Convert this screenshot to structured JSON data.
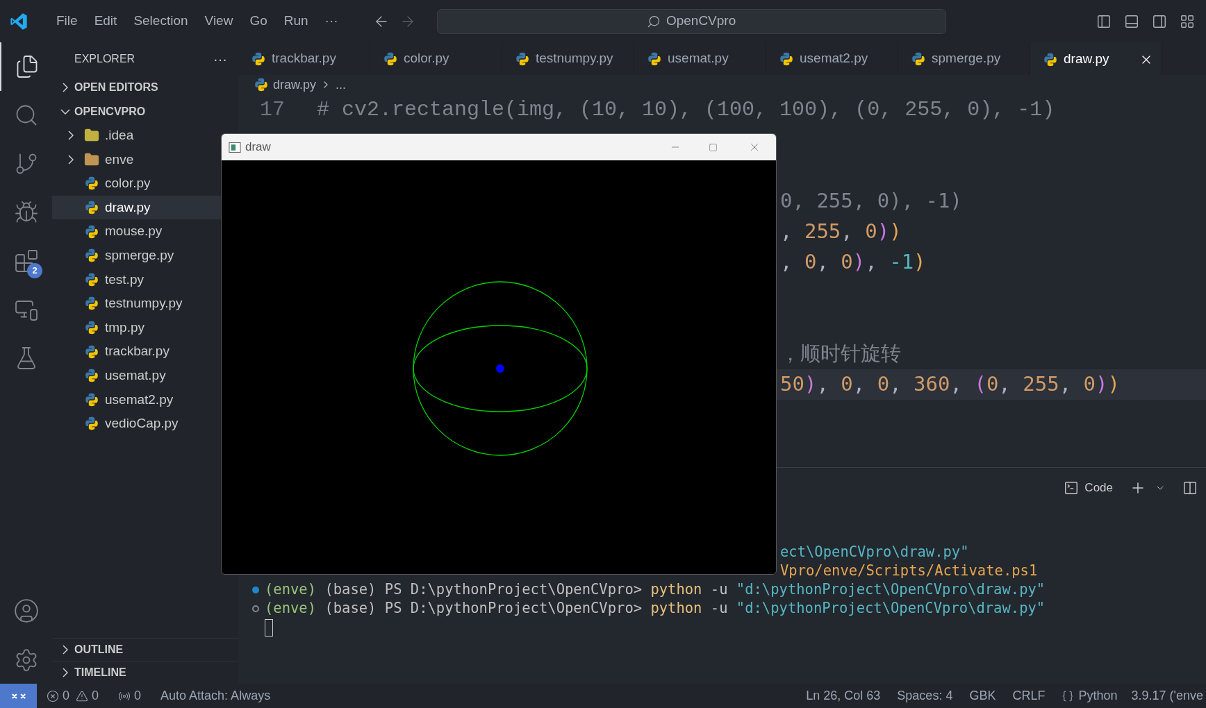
{
  "menu": [
    "File",
    "Edit",
    "Selection",
    "View",
    "Go",
    "Run",
    "···"
  ],
  "search": {
    "value": "OpenCVpro"
  },
  "activity": [
    {
      "selected": true
    },
    {
      "selected": false
    },
    {
      "selected": false
    },
    {
      "selected": false
    },
    {
      "selected": false,
      "badge": "2"
    },
    {
      "selected": false
    },
    {
      "selected": false
    }
  ],
  "sidebar": {
    "title": "EXPLORER",
    "more": "···",
    "sections": [
      {
        "label": "OPEN EDITORS",
        "expanded": false
      },
      {
        "label": "OPENCVPRO",
        "expanded": true
      }
    ],
    "items": [
      {
        "kind": "folder",
        "label": ".idea",
        "color": "#c0b040",
        "selected": false
      },
      {
        "kind": "folder",
        "label": "enve",
        "color": "#c09553",
        "selected": false
      },
      {
        "kind": "file",
        "label": "color.py",
        "selected": false
      },
      {
        "kind": "file",
        "label": "draw.py",
        "selected": true
      },
      {
        "kind": "file",
        "label": "mouse.py",
        "selected": false
      },
      {
        "kind": "file",
        "label": "spmerge.py",
        "selected": false
      },
      {
        "kind": "file",
        "label": "test.py",
        "selected": false
      },
      {
        "kind": "file",
        "label": "testnumpy.py",
        "selected": false
      },
      {
        "kind": "file",
        "label": "tmp.py",
        "selected": false
      },
      {
        "kind": "file",
        "label": "trackbar.py",
        "selected": false
      },
      {
        "kind": "file",
        "label": "usemat.py",
        "selected": false
      },
      {
        "kind": "file",
        "label": "usemat2.py",
        "selected": false
      },
      {
        "kind": "file",
        "label": "vedioCap.py",
        "selected": false
      }
    ],
    "bottom_sections": [
      {
        "label": "OUTLINE",
        "expanded": false
      },
      {
        "label": "TIMELINE",
        "expanded": false
      }
    ]
  },
  "tabs": [
    {
      "label": "trackbar.py",
      "selected": false
    },
    {
      "label": "color.py",
      "selected": false
    },
    {
      "label": "testnumpy.py",
      "selected": false
    },
    {
      "label": "usemat.py",
      "selected": false
    },
    {
      "label": "usemat2.py",
      "selected": false
    },
    {
      "label": "spmerge.py",
      "selected": false
    },
    {
      "label": "draw.py",
      "selected": true
    }
  ],
  "breadcrumb": [
    "draw.py",
    "..."
  ],
  "editor_lines": [
    {
      "kind": "full",
      "number": "17",
      "current": false,
      "tokens": [
        {
          "text": "# cv2.rectangle(img, (10, 10), (100, 100), (0, 255, 0), -1)",
          "kind": "comment"
        }
      ]
    },
    {
      "kind": "covered"
    },
    {
      "kind": "covered"
    },
    {
      "kind": "partial",
      "current": false,
      "tokens": [
        {
          "text": "0, 255, 0), -1)",
          "kind": "comment"
        }
      ]
    },
    {
      "kind": "partial",
      "current": false,
      "tokens": [
        {
          "text": ", ",
          "kind": "punct"
        },
        {
          "text": "255",
          "kind": "number"
        },
        {
          "text": ", ",
          "kind": "punct"
        },
        {
          "text": "0",
          "kind": "number"
        },
        {
          "text": ")",
          "kind": "bracket2"
        },
        {
          "text": ")",
          "kind": "bracket1"
        }
      ]
    },
    {
      "kind": "partial",
      "current": false,
      "tokens": [
        {
          "text": ", ",
          "kind": "punct"
        },
        {
          "text": "0",
          "kind": "number"
        },
        {
          "text": ", ",
          "kind": "punct"
        },
        {
          "text": "0",
          "kind": "number"
        },
        {
          "text": ")",
          "kind": "bracket2"
        },
        {
          "text": ", ",
          "kind": "punct"
        },
        {
          "text": "-1",
          "kind": "operator"
        },
        {
          "text": ")",
          "kind": "bracket1"
        }
      ]
    },
    {
      "kind": "covered"
    },
    {
      "kind": "covered"
    },
    {
      "kind": "partial",
      "current": false,
      "tokens": [
        {
          "text": "，顺时针旋转",
          "kind": "comment"
        }
      ]
    },
    {
      "kind": "partial",
      "current": true,
      "tokens": [
        {
          "text": "50",
          "kind": "number"
        },
        {
          "text": ")",
          "kind": "bracket2"
        },
        {
          "text": ", ",
          "kind": "punct"
        },
        {
          "text": "0",
          "kind": "number"
        },
        {
          "text": ", ",
          "kind": "punct"
        },
        {
          "text": "0",
          "kind": "number"
        },
        {
          "text": ", ",
          "kind": "punct"
        },
        {
          "text": "360",
          "kind": "number"
        },
        {
          "text": ", ",
          "kind": "punct"
        },
        {
          "text": "(",
          "kind": "bracket2"
        },
        {
          "text": "0",
          "kind": "number"
        },
        {
          "text": ", ",
          "kind": "punct"
        },
        {
          "text": "255",
          "kind": "number"
        },
        {
          "text": ", ",
          "kind": "punct"
        },
        {
          "text": "0",
          "kind": "number"
        },
        {
          "text": ")",
          "kind": "bracket2"
        },
        {
          "text": ")",
          "kind": "bracket1"
        }
      ]
    }
  ],
  "terminal": {
    "profile": "Code",
    "lines": [
      {
        "kind": "partial",
        "tokens": [
          {
            "text": "ect\\OpenCVpro\\draw.py\"",
            "kind": "string"
          }
        ]
      },
      {
        "kind": "partial",
        "tokens": [
          {
            "text": "Vpro/enve/Scripts/Activate.ps1",
            "kind": "path"
          }
        ]
      },
      {
        "kind": "prompt",
        "succeeded": true,
        "tokens": [
          {
            "text": "(enve)",
            "kind": "env"
          },
          {
            "text": " (base) PS D:\\pythonProject\\OpenCVpro> ",
            "kind": "plain"
          },
          {
            "text": "python",
            "kind": "command"
          },
          {
            "text": " -u ",
            "kind": "plain"
          },
          {
            "text": "\"d:\\pythonProject\\OpenCVpro\\draw.py\"",
            "kind": "string"
          }
        ]
      },
      {
        "kind": "prompt",
        "succeeded": false,
        "tokens": [
          {
            "text": "(enve)",
            "kind": "env"
          },
          {
            "text": " (base) PS D:\\pythonProject\\OpenCVpro> ",
            "kind": "plain"
          },
          {
            "text": "python",
            "kind": "command"
          },
          {
            "text": " -u ",
            "kind": "plain"
          },
          {
            "text": "\"d:\\pythonProject\\OpenCVpro\\draw.py\"",
            "kind": "string"
          }
        ]
      },
      {
        "kind": "cursor"
      }
    ]
  },
  "window": {
    "title": "draw"
  },
  "status_bar": {
    "errors": "0",
    "warnings": "0",
    "ports": "0",
    "attach": "Auto Attach: Always",
    "right": [
      "Ln 26, Col 63",
      "Spaces: 4",
      "GBK",
      "CRLF"
    ],
    "language": "Python",
    "interpreter": "3.9.17 ('enve"
  }
}
